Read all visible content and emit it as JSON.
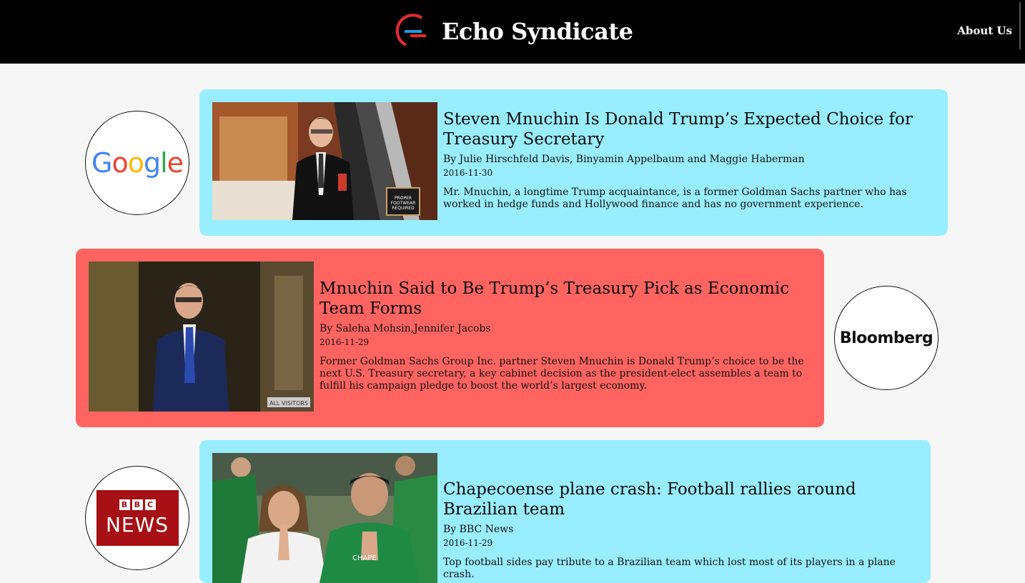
{
  "header": {
    "site_name": "Echo Syndicate",
    "about_label": "About Us"
  },
  "articles": [
    {
      "source": "Google",
      "headline": "Steven Mnuchin Is Donald Trump’s Expected Choice for Treasury Secretary",
      "byline": "By Julie Hirschfeld Davis, Binyamin Appelbaum and Maggie Haberman",
      "date": "2016-11-30",
      "summary": "Mr. Mnuchin, a longtime Trump acquaintance, is a former Goldman Sachs partner who has worked in hedge funds and Hollywood finance and has no government experience.",
      "photo_sign": "PROPER FOOTWEAR REQUIRED"
    },
    {
      "source": "Bloomberg",
      "headline": "Mnuchin Said to Be Trump’s Treasury Pick as Economic Team Forms",
      "byline": "By Saleha Mohsin,Jennifer Jacobs",
      "date": "2016-11-29",
      "summary": "Former Goldman Sachs Group Inc. partner Steven Mnuchin is Donald Trump’s choice to be the next U.S. Treasury secretary, a key cabinet decision as the president-elect assembles a team to fulfill his campaign pledge to boost the world’s largest economy.",
      "photo_sign": "ALL VISITORS"
    },
    {
      "source": "BBC News",
      "headline": "Chapecoense plane crash: Football rallies around Brazilian team",
      "byline": "By BBC News",
      "date": "2016-11-29",
      "summary": "Top football sides pay tribute to a Brazilian team which lost most of its players in a plane crash."
    }
  ],
  "logos": {
    "google": "Google",
    "bloomberg": "Bloomberg",
    "bbc_letters": [
      "B",
      "B",
      "C"
    ],
    "bbc_word": "NEWS"
  },
  "colors": {
    "card_blue": "#98eefe",
    "card_red": "#ff6461",
    "header_bg": "#000000"
  }
}
